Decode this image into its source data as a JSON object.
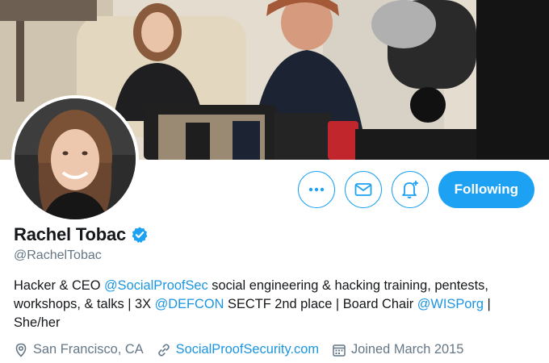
{
  "profile": {
    "display_name": "Rachel Tobac",
    "handle": "@RachelTobac",
    "verified": true
  },
  "actions": {
    "more_icon": "more-dots-icon",
    "message_icon": "envelope-icon",
    "notify_icon": "bell-plus-icon",
    "following_label": "Following"
  },
  "bio": {
    "segments": [
      {
        "type": "text",
        "value": "Hacker & CEO "
      },
      {
        "type": "mention",
        "value": "@SocialProofSec"
      },
      {
        "type": "text",
        "value": " social engineering & hacking training, pentests, workshops, & talks | 3X "
      },
      {
        "type": "mention",
        "value": "@DEFCON"
      },
      {
        "type": "text",
        "value": " SECTF 2nd place | Board Chair "
      },
      {
        "type": "mention",
        "value": "@WISPorg"
      },
      {
        "type": "text",
        "value": " | She/her"
      }
    ]
  },
  "meta": {
    "location": "San Francisco, CA",
    "website": "SocialProofSecurity.com",
    "joined": "Joined March 2015"
  },
  "colors": {
    "accent": "#1da1f2",
    "link": "#1b95e0",
    "secondary_text": "#657786",
    "primary_text": "#14171a"
  }
}
